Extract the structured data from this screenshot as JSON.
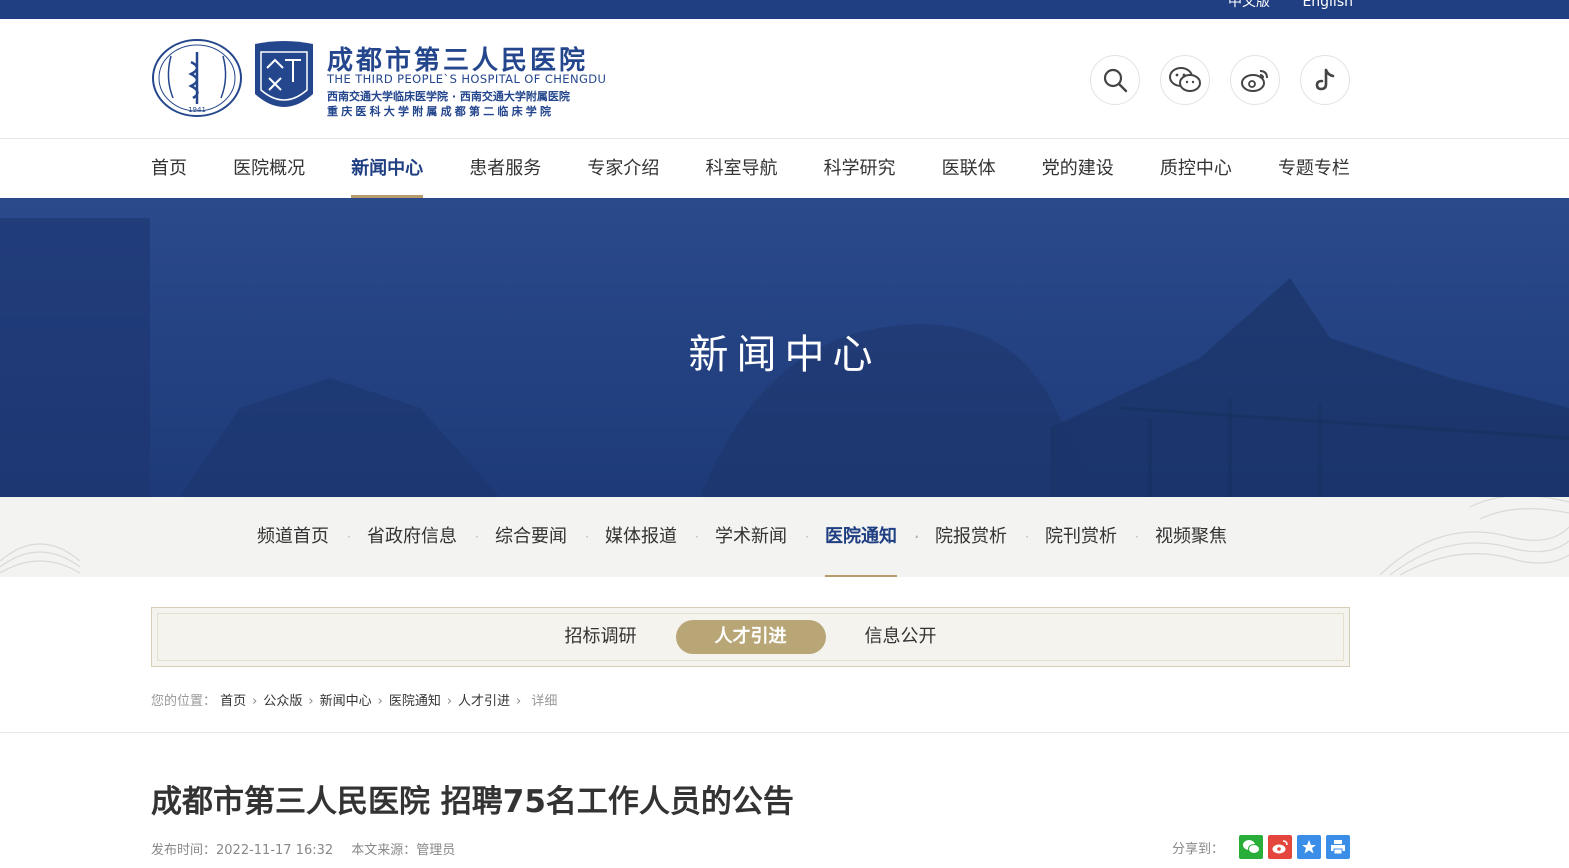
{
  "topbar": {
    "links": [
      "中文版",
      "English"
    ]
  },
  "logo": {
    "title": "成都市第三人民医院",
    "english": "THE THIRD PEOPLE`S HOSPITAL OF CHENGDU",
    "sub1": "西南交通大学临床医学院 · 西南交通大学附属医院",
    "sub2": "重庆医科大学附属成都第二临床学院",
    "seal_year": "1941"
  },
  "socials": [
    "search-icon",
    "wechat-icon",
    "weibo-icon",
    "douyin-icon"
  ],
  "nav": {
    "items": [
      "首页",
      "医院概况",
      "新闻中心",
      "患者服务",
      "专家介绍",
      "科室导航",
      "科学研究",
      "医联体",
      "党的建设",
      "质控中心",
      "专题专栏"
    ],
    "active": "新闻中心"
  },
  "banner": {
    "title": "新闻中心"
  },
  "subnav": {
    "items": [
      "频道首页",
      "省政府信息",
      "综合要闻",
      "媒体报道",
      "学术新闻",
      "医院通知",
      "院报赏析",
      "院刊赏析",
      "视频聚焦"
    ],
    "active": "医院通知"
  },
  "tabs": {
    "items": [
      "招标调研",
      "人才引进",
      "信息公开"
    ],
    "active": "人才引进"
  },
  "breadcrumb": {
    "label": "您的位置：",
    "items": [
      "首页",
      "公众版",
      "新闻中心",
      "医院通知",
      "人才引进"
    ],
    "current": "详细"
  },
  "article": {
    "title": "成都市第三人民医院 招聘75名工作人员的公告",
    "published": "发布时间：2022-11-17 16:32",
    "source": "本文来源：管理员",
    "share_label": "分享到："
  },
  "colors": {
    "brand": "#1f3f82",
    "accent": "#b89b6a",
    "tab_active": "#b9a677"
  }
}
